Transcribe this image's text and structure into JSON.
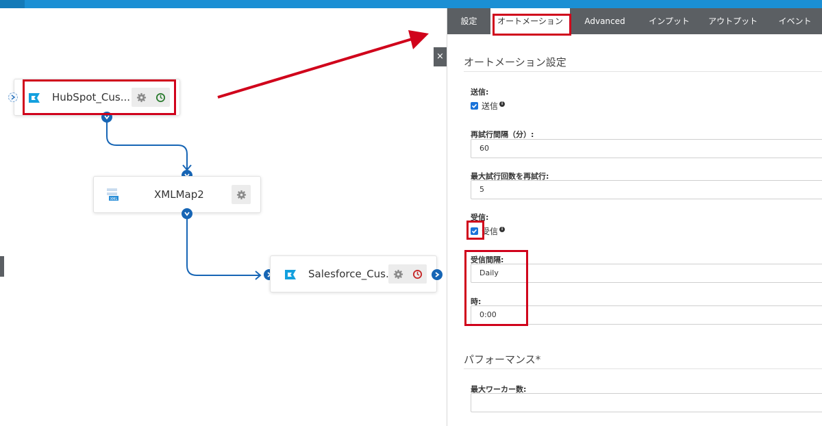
{
  "canvas": {
    "nodes": [
      {
        "name": "HubSpot_Cus..."
      },
      {
        "name": "XMLMap2"
      },
      {
        "name": "Salesforce_Cus..."
      }
    ]
  },
  "panel": {
    "close_label": "×",
    "tabs": [
      {
        "label": "設定"
      },
      {
        "label": "オートメーション"
      },
      {
        "label": "Advanced"
      },
      {
        "label": "インプット"
      },
      {
        "label": "アウトプット"
      },
      {
        "label": "イベント"
      }
    ],
    "automation": {
      "section_title": "オートメーション設定",
      "send_label": "送信:",
      "send_checkbox_label": "送信",
      "send_checked": true,
      "retry_interval_label": "再試行間隔（分）:",
      "retry_interval_value": "60",
      "max_retry_label": "最大試行回数を再試行:",
      "max_retry_value": "5",
      "receive_label": "受信:",
      "receive_checkbox_label": "受信",
      "receive_checked": true,
      "receive_interval_label": "受信間隔:",
      "receive_interval_value": "Daily",
      "hour_label": "時:",
      "hour_value": "0:00"
    },
    "performance": {
      "section_title": "パフォーマンス*",
      "max_workers_label": "最大ワーカー数:",
      "max_workers_value": ""
    },
    "info_glyph": "i"
  },
  "colors": {
    "accent": "#1b8fd4",
    "tabbar": "#5b5f63",
    "connector": "#1665b5",
    "highlight": "#d0021b"
  }
}
